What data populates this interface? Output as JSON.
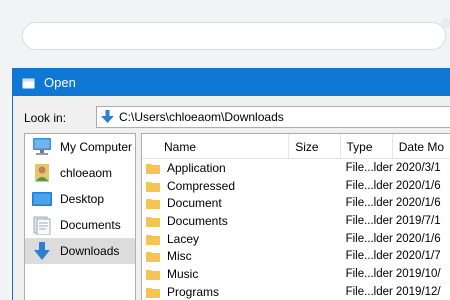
{
  "dialog": {
    "title": "Open",
    "look_in_label": "Look in:",
    "look_in_path": "C:\\Users\\chloeaom\\Downloads"
  },
  "places": [
    {
      "label": "My Computer",
      "icon": "computer-icon"
    },
    {
      "label": "chloeaom",
      "icon": "user-icon"
    },
    {
      "label": "Desktop",
      "icon": "desktop-icon"
    },
    {
      "label": "Documents",
      "icon": "documents-icon"
    },
    {
      "label": "Downloads",
      "icon": "downloads-icon",
      "selected": true
    }
  ],
  "columns": {
    "name": "Name",
    "size": "Size",
    "type": "Type",
    "date": "Date Mo"
  },
  "files": [
    {
      "name": "Application",
      "type": "File...lder",
      "date": "2020/3/1"
    },
    {
      "name": "Compressed",
      "type": "File...lder",
      "date": "2020/1/6"
    },
    {
      "name": "Document",
      "type": "File...lder",
      "date": "2020/1/6"
    },
    {
      "name": "Documents",
      "type": "File...lder",
      "date": "2019/7/1"
    },
    {
      "name": "Lacey",
      "type": "File...lder",
      "date": "2020/1/6"
    },
    {
      "name": "Misc",
      "type": "File...lder",
      "date": "2020/1/7"
    },
    {
      "name": "Music",
      "type": "File...lder",
      "date": "2019/10/"
    },
    {
      "name": "Programs",
      "type": "File...lder",
      "date": "2019/12/"
    }
  ],
  "colors": {
    "titlebar": "#0f78d4",
    "folder": "#f4c553",
    "accent": "#2b7fd4"
  }
}
